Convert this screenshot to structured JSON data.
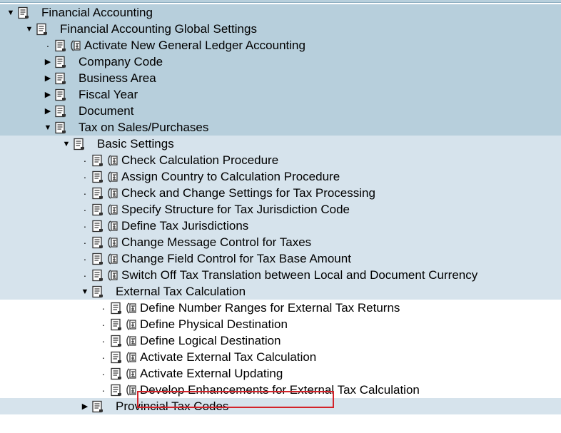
{
  "tree": {
    "top_partial_label": "",
    "nodes": [
      {
        "level": 0,
        "type": "folder",
        "expanded": true,
        "label": "Financial Accounting",
        "bg": "dark"
      },
      {
        "level": 1,
        "type": "folder",
        "expanded": true,
        "label": "Financial Accounting Global Settings",
        "bg": "dark"
      },
      {
        "level": 2,
        "type": "activity",
        "label": "Activate New General Ledger Accounting",
        "bg": "dark"
      },
      {
        "level": 2,
        "type": "folder",
        "expanded": false,
        "label": "Company Code",
        "bg": "dark"
      },
      {
        "level": 2,
        "type": "folder",
        "expanded": false,
        "label": "Business Area",
        "bg": "dark"
      },
      {
        "level": 2,
        "type": "folder",
        "expanded": false,
        "label": "Fiscal Year",
        "bg": "dark"
      },
      {
        "level": 2,
        "type": "folder",
        "expanded": false,
        "label": "Document",
        "bg": "dark"
      },
      {
        "level": 2,
        "type": "folder",
        "expanded": true,
        "label": "Tax on Sales/Purchases",
        "bg": "dark"
      },
      {
        "level": 3,
        "type": "folder",
        "expanded": true,
        "label": "Basic Settings",
        "bg": "light"
      },
      {
        "level": 4,
        "type": "activity",
        "label": "Check Calculation Procedure",
        "bg": "light"
      },
      {
        "level": 4,
        "type": "activity",
        "label": "Assign Country to Calculation Procedure",
        "bg": "light"
      },
      {
        "level": 4,
        "type": "activity",
        "label": "Check and Change Settings for Tax Processing",
        "bg": "light"
      },
      {
        "level": 4,
        "type": "activity",
        "label": "Specify Structure for Tax Jurisdiction Code",
        "bg": "light"
      },
      {
        "level": 4,
        "type": "activity",
        "label": "Define Tax Jurisdictions",
        "bg": "light"
      },
      {
        "level": 4,
        "type": "activity",
        "label": "Change Message Control for Taxes",
        "bg": "light"
      },
      {
        "level": 4,
        "type": "activity",
        "label": "Change Field Control for Tax Base Amount",
        "bg": "light"
      },
      {
        "level": 4,
        "type": "activity",
        "label": "Switch Off Tax Translation between Local and Document Currency",
        "bg": "light"
      },
      {
        "level": 4,
        "type": "folder",
        "expanded": true,
        "label": "External Tax Calculation",
        "bg": "light"
      },
      {
        "level": 5,
        "type": "activity",
        "label": "Define Number Ranges for External Tax Returns",
        "bg": "white"
      },
      {
        "level": 5,
        "type": "activity",
        "label": "Define Physical Destination",
        "bg": "white"
      },
      {
        "level": 5,
        "type": "activity",
        "label": "Define Logical Destination",
        "bg": "white"
      },
      {
        "level": 5,
        "type": "activity",
        "label": "Activate External Tax Calculation",
        "bg": "white"
      },
      {
        "level": 5,
        "type": "activity",
        "label": "Activate External Updating",
        "bg": "white",
        "highlighted": true
      },
      {
        "level": 5,
        "type": "activity",
        "label": "Develop Enhancements for External Tax Calculation",
        "bg": "white"
      },
      {
        "level": 4,
        "type": "folder",
        "expanded": false,
        "label": "Provincial Tax Codes",
        "bg": "light"
      }
    ]
  },
  "colors": {
    "row_dark": "#b7cfdc",
    "row_light": "#d6e3ec",
    "row_white": "#ffffff",
    "highlight": "#d3232a"
  },
  "icons": {
    "folder_node": "document-lines-icon",
    "activity_doc": "document-lines-icon",
    "activity_exec": "clock-execute-icon",
    "expanded": "triangle-down-icon",
    "collapsed": "triangle-right-icon"
  }
}
